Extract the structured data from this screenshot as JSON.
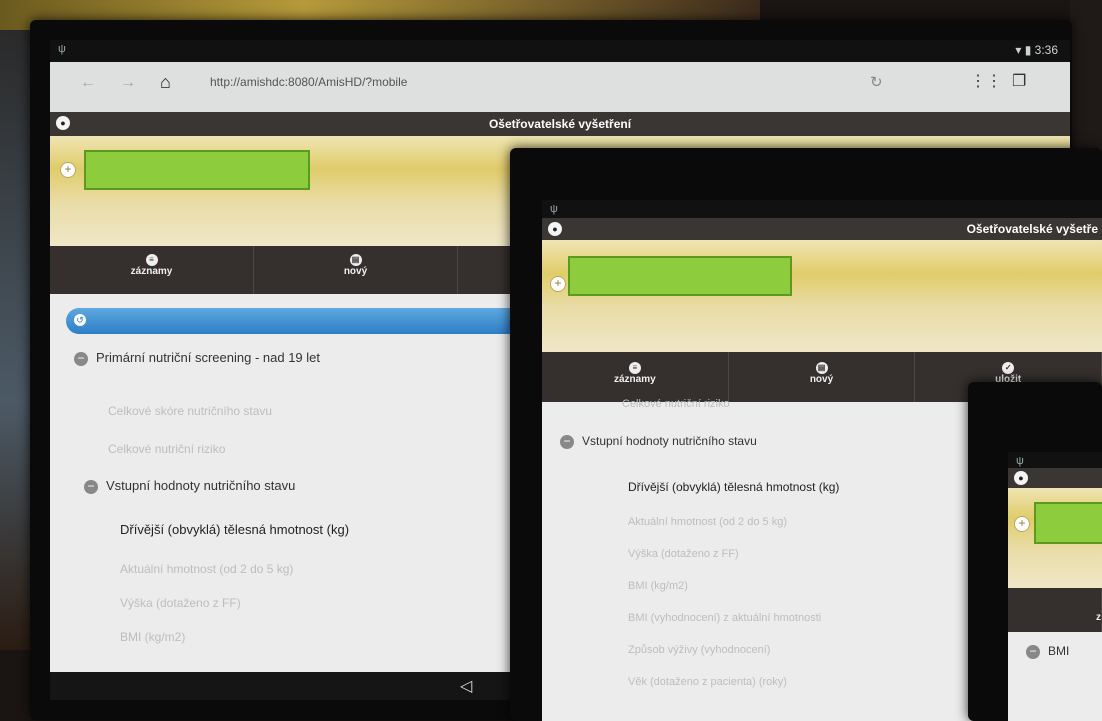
{
  "status": {
    "time": "3:36"
  },
  "browser": {
    "url": "http://amishdc:8080/AmisHD/?mobile"
  },
  "page_title": "Ošetřovatelské vyšetření",
  "page_title_cropped": "Ošetřovatelské vyšetře",
  "toolbar": {
    "records": "záznamy",
    "new": "nový",
    "save": "uložit"
  },
  "left_screen": {
    "section1": "Primární nutriční screening - nad 19 let",
    "items_faded": [
      "Celkové skóre nutričního stavu",
      "Celkové nutriční riziko"
    ],
    "section2": "Vstupní hodnoty nutričního stavu",
    "active_item": "Dřívější (obvyklá) tělesná hmotnost (kg)",
    "items_faded2": [
      "Aktuální hmotnost (od 2 do 5 kg)",
      "Výška (dotaženo z FF)",
      "BMI (kg/m2)"
    ]
  },
  "middle_screen": {
    "faded_top": "Celkové nutriční riziko",
    "section": "Vstupní hodnoty nutričního stavu",
    "active_item": "Dřívější (obvyklá) tělesná hmotnost (kg)",
    "items_faded": [
      "Aktuální hmotnost (od 2 do 5 kg)",
      "Výška (dotaženo z FF)",
      "BMI (kg/m2)",
      "BMI (vyhodnocení) z aktuální hmotnosti",
      "Způsob výživy (vyhodnocení)",
      "Věk (dotaženo z pacienta) (roky)"
    ]
  },
  "right_screen": {
    "toolbar_fragment": "z",
    "section_fragment": "BMI"
  },
  "colors": {
    "accent_blue": "#2d7fc7",
    "redaction_green": "#8dcc3c",
    "title_bg": "#3a3634"
  }
}
